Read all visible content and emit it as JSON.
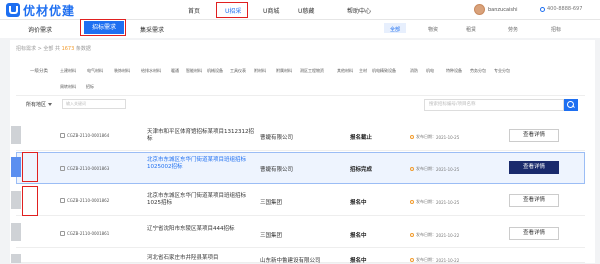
{
  "brand": {
    "name": "优材优建"
  },
  "nav": {
    "items": [
      {
        "label": "首页"
      },
      {
        "label": "U招采"
      },
      {
        "label": "U商城"
      },
      {
        "label": "U慈藏"
      },
      {
        "label": "帮助中心"
      }
    ],
    "active_index": 1
  },
  "user": {
    "name": "banzucaishi",
    "phone": "400-8888-697"
  },
  "tabs": {
    "items": [
      "询价需求",
      "招标需求",
      "集采需求"
    ],
    "active_index": 1
  },
  "categories": [
    "全部",
    "物资",
    "租赁",
    "劳务",
    "招标"
  ],
  "breadcrumb": {
    "path": "招标需求 > 全部 共",
    "count": "1673",
    "suffix": "条数据"
  },
  "filters": {
    "label": "一级分类",
    "items": [
      "土建材料",
      "电气材料",
      "装饰材料",
      "给排水材料",
      "暖通",
      "智能材料",
      "机械设备",
      "工具仪表",
      "附材料",
      "附属材料",
      "测区工程物资",
      "其他材料",
      "主材",
      "机电精致设备",
      "消防",
      "机电",
      "特种设备",
      "劳务分包",
      "专业分包",
      "周转材料",
      "招标"
    ]
  },
  "controls": {
    "type_select": "所有地区",
    "keyword_placeholder": "输入关键词",
    "search_placeholder": "搜索招标编号/项目名称"
  },
  "rows": [
    {
      "code": "CGZB-2110-0001864",
      "title": "天津市和平区体育馆招标某项目1312312招标",
      "company": "曹婕有限公司",
      "status": "报名截止",
      "date_label": "发布日期：",
      "date": "2021-10-25",
      "action": "查看详情"
    },
    {
      "code": "CGZB-2110-0001863",
      "title": "北京市东城区东华门街道某项目班组招标1025002招标",
      "company": "曹婕有限公司",
      "status": "招标完成",
      "date_label": "发布日期：",
      "date": "2021-10-25",
      "action": "查看详情"
    },
    {
      "code": "CGZB-2110-0001862",
      "title": "北京市东城区东华门街道某项目班组招标1025招标",
      "company": "三国集团",
      "status": "报名中",
      "date_label": "发布日期：",
      "date": "2021-10-25",
      "action": "查看详情"
    },
    {
      "code": "CGZB-2110-0001861",
      "title": "辽宁省沈阳市东陵区某项目444招标",
      "company": "三国集团",
      "status": "报名中",
      "date_label": "发布日期：",
      "date": "2021-10-22",
      "action": "查看详情"
    },
    {
      "code": "",
      "title": "河北省石家庄市井陉县某项目",
      "company": "山东新中鲁建设有限公司",
      "status": "报名中",
      "date_label": "发布日期：",
      "date": "2021-10-22",
      "action": ""
    }
  ]
}
